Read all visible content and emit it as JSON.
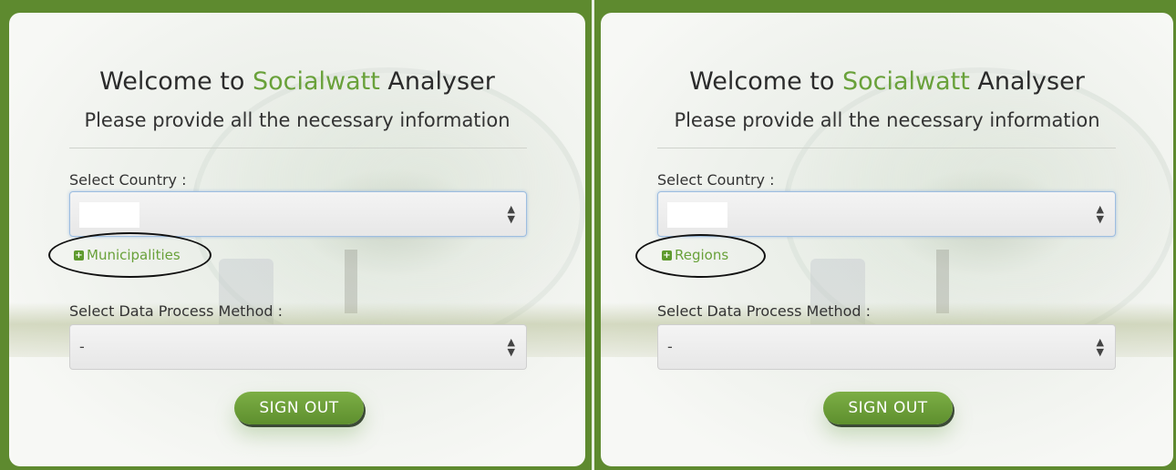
{
  "colors": {
    "accent": "#69a13a",
    "frame": "#5e8a2f",
    "button": "#6a9e38"
  },
  "panels": [
    {
      "title_prefix": "Welcome to",
      "title_brand": "Socialwatt",
      "title_suffix": "Analyser",
      "subtitle": "Please provide all the necessary information",
      "country_label": "Select Country :",
      "country_value": "",
      "expand_link": "Municipalities",
      "method_label": "Select Data Process Method :",
      "method_value": "-",
      "signout_label": "SIGN OUT"
    },
    {
      "title_prefix": "Welcome to",
      "title_brand": "Socialwatt",
      "title_suffix": "Analyser",
      "subtitle": "Please provide all the necessary information",
      "country_label": "Select Country :",
      "country_value": "",
      "expand_link": "Regions",
      "method_label": "Select Data Process Method :",
      "method_value": "-",
      "signout_label": "SIGN OUT"
    }
  ]
}
